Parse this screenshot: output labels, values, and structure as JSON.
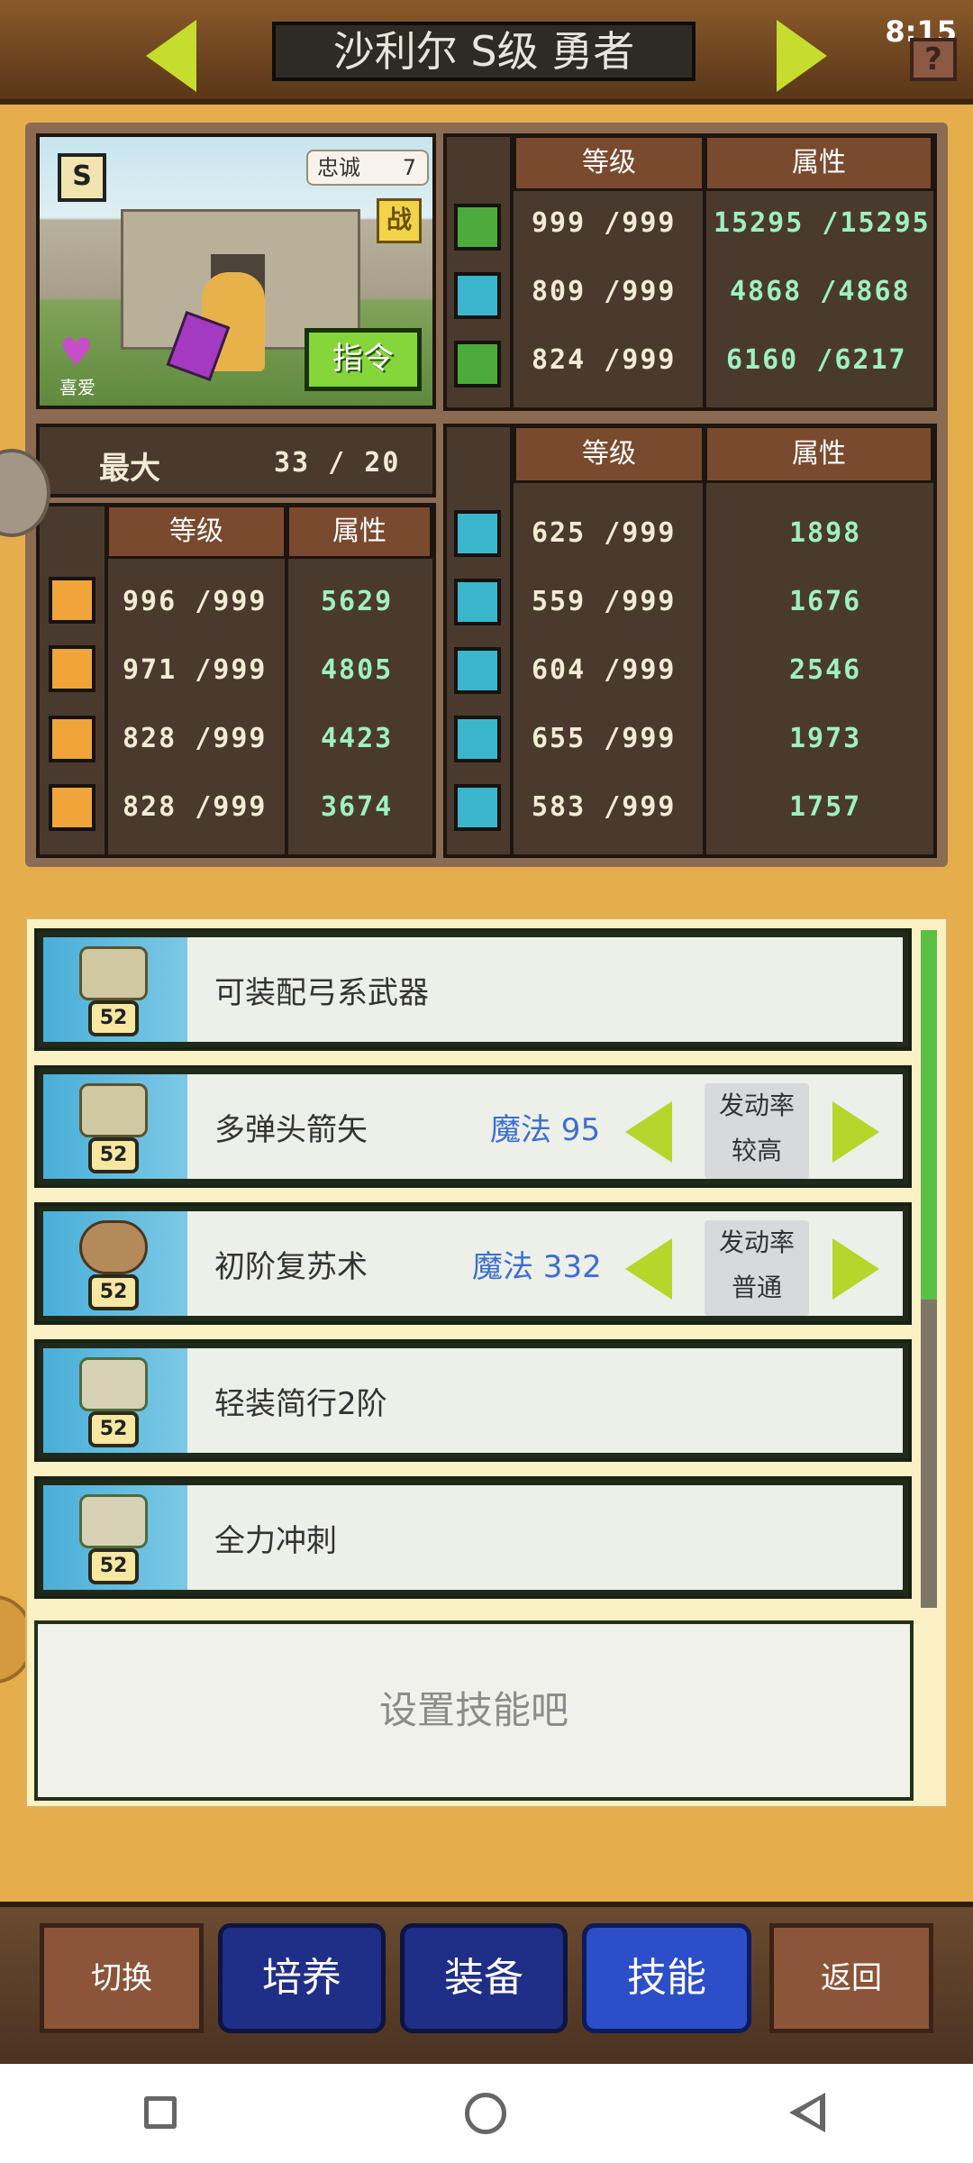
{
  "header": {
    "title": "沙利尔 S级 勇者",
    "clock": "8:15"
  },
  "portrait": {
    "rank": "S",
    "loyalty_label": "忠诚",
    "loyalty_value": "7",
    "battle_badge": "战",
    "command_label": "指令",
    "like_label": "喜爱"
  },
  "vitals": {
    "headers": [
      "等级",
      "属性"
    ],
    "rows": [
      {
        "icon": "heart-icon",
        "level": "999 /999",
        "value": "15295 /15295"
      },
      {
        "icon": "potion-icon",
        "level": "809 /999",
        "value": "4868 /4868"
      },
      {
        "icon": "stamina-icon",
        "level": "824 /999",
        "value": "6160 /6217"
      }
    ]
  },
  "age": {
    "label": "最大",
    "value": "33 /  20"
  },
  "combat": {
    "headers": [
      "等级",
      "属性"
    ],
    "rows": [
      {
        "icon": "sword-icon",
        "level": "996 /999",
        "value": "5629"
      },
      {
        "icon": "shield-icon",
        "level": "971 /999",
        "value": "4805"
      },
      {
        "icon": "agility-icon",
        "level": "828 /999",
        "value": "4423"
      },
      {
        "icon": "star-icon",
        "level": "828 /999",
        "value": "3674"
      }
    ]
  },
  "work": {
    "headers": [
      "等级",
      "属性"
    ],
    "rows": [
      {
        "icon": "book-icon",
        "level": "625 /999",
        "value": "1898"
      },
      {
        "icon": "pickaxe-icon",
        "level": "559 /999",
        "value": "1676"
      },
      {
        "icon": "shovel-icon",
        "level": "604 /999",
        "value": "2546"
      },
      {
        "icon": "craft-icon",
        "level": "655 /999",
        "value": "1973"
      },
      {
        "icon": "hammer-icon",
        "level": "583 /999",
        "value": "1757"
      }
    ]
  },
  "skills": [
    {
      "name": "可装配弓系武器",
      "level": "52",
      "icon": "bow-skill-icon"
    },
    {
      "name": "多弹头箭矢",
      "level": "52",
      "icon": "bow-skill-icon",
      "cost": "魔法 95",
      "rate_label": "发动率",
      "rate_value": "较高"
    },
    {
      "name": "初阶复苏术",
      "level": "52",
      "icon": "staff-skill-icon",
      "cost": "魔法 332",
      "rate_label": "发动率",
      "rate_value": "普通"
    },
    {
      "name": "轻装简行2阶",
      "level": "52",
      "icon": "scroll-skill-icon"
    },
    {
      "name": "全力冲刺",
      "level": "52",
      "icon": "scroll-skill-icon"
    }
  ],
  "empty_skill": "设置技能吧",
  "nav": {
    "switch": "切换",
    "train": "培养",
    "equip": "装备",
    "skill": "技能",
    "back": "返回"
  },
  "colors": {
    "background": "#e6ad4d",
    "accent_green": "#b7d52a",
    "active_tab": "#2c4ec8",
    "magic_text": "#3d6fcf"
  }
}
